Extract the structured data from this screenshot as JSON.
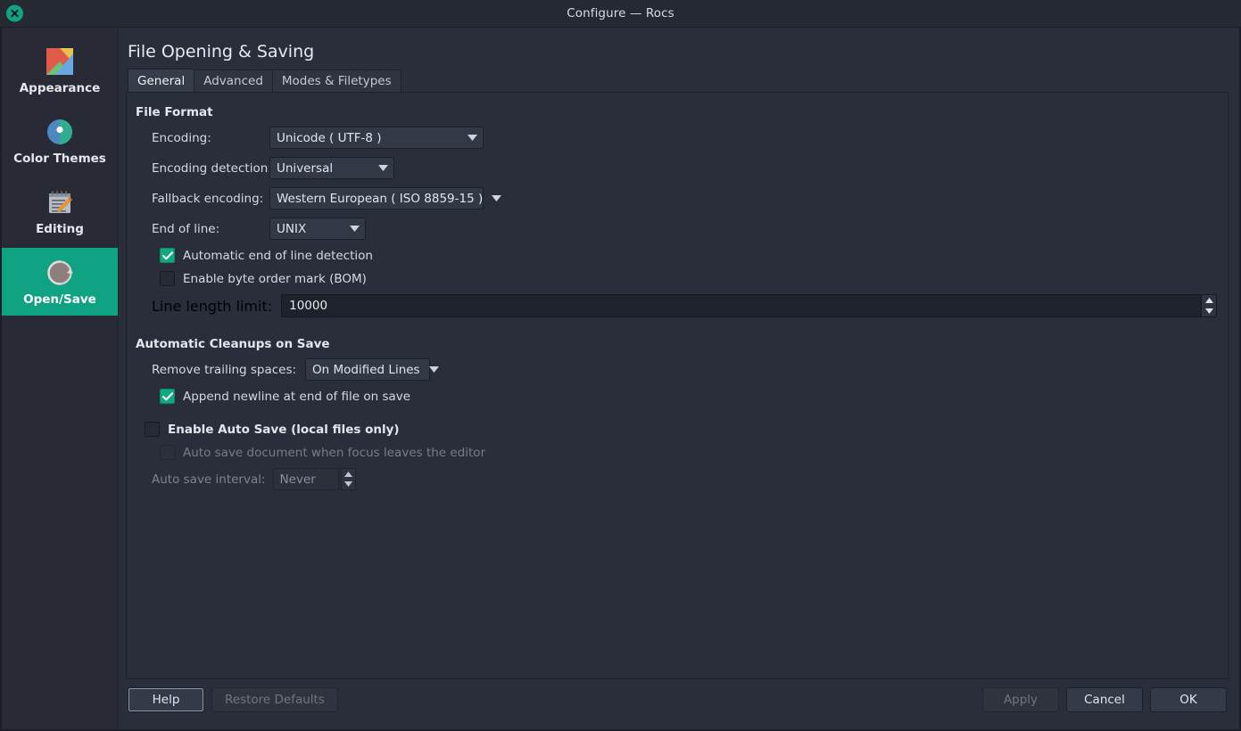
{
  "window": {
    "title": "Configure — Rocs",
    "close_icon": "close-x-icon"
  },
  "sidebar": {
    "items": [
      {
        "label": "Appearance",
        "icon": "appearance-icon",
        "active": false
      },
      {
        "label": "Color Themes",
        "icon": "color-themes-icon",
        "active": false
      },
      {
        "label": "Editing",
        "icon": "editing-icon",
        "active": false
      },
      {
        "label": "Open/Save",
        "icon": "open-save-icon",
        "active": true
      }
    ]
  },
  "page": {
    "title": "File Opening & Saving",
    "tabs": [
      {
        "label": "General",
        "active": true
      },
      {
        "label": "Advanced",
        "active": false
      },
      {
        "label": "Modes & Filetypes",
        "active": false
      }
    ]
  },
  "file_format": {
    "group_label": "File Format",
    "encoding_label": "Encoding:",
    "encoding_value": "Unicode ( UTF-8 )",
    "encoding_detection_label": "Encoding detection:",
    "encoding_detection_value": "Universal",
    "fallback_encoding_label": "Fallback encoding:",
    "fallback_encoding_value": "Western European ( ISO 8859-15 )",
    "end_of_line_label": "End of line:",
    "end_of_line_value": "UNIX",
    "auto_eol_label": "Automatic end of line detection",
    "auto_eol_checked": true,
    "bom_label": "Enable byte order mark (BOM)",
    "bom_checked": false,
    "line_length_label": "Line length limit:",
    "line_length_value": "10000"
  },
  "cleanups": {
    "group_label": "Automatic Cleanups on Save",
    "trailing_label": "Remove trailing spaces:",
    "trailing_value": "On Modified Lines",
    "append_newline_label": "Append newline at end of file on save",
    "append_newline_checked": true
  },
  "autosave": {
    "enable_label": "Enable Auto Save (local files only)",
    "enable_checked": false,
    "focus_label": "Auto save document when focus leaves the editor",
    "focus_checked": false,
    "interval_label": "Auto save interval:",
    "interval_value": "Never"
  },
  "footer": {
    "help": "Help",
    "restore_defaults": "Restore Defaults",
    "apply": "Apply",
    "cancel": "Cancel",
    "ok": "OK"
  },
  "colors": {
    "accent": "#0fa383",
    "window_bg": "#2a2e3a",
    "sidebar_bg": "#282b36",
    "field_bg": "#323846",
    "input_bg": "#1e222b",
    "text": "#e2e5eb",
    "text_dim": "#7d8290"
  }
}
